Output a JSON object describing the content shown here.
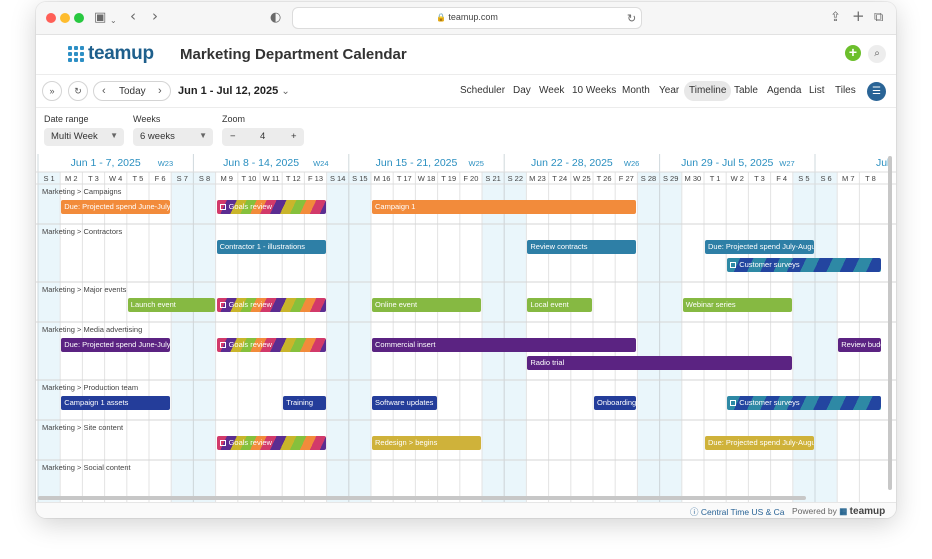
{
  "browser": {
    "url": "teamup.com",
    "traffic_lights": [
      "#ff5f57",
      "#febc2e",
      "#28c840"
    ]
  },
  "app": {
    "logo": "teamup",
    "title": "Marketing Department Calendar",
    "add_label": "+",
    "search_label": "⌕"
  },
  "toolbar": {
    "today": "Today",
    "range": "Jun 1 - Jul 12, 2025",
    "views": [
      "Scheduler",
      "Day",
      "Week",
      "10 Weeks",
      "Month",
      "Year",
      "Timeline",
      "Table",
      "Agenda",
      "List",
      "Tiles"
    ],
    "active_view": "Timeline"
  },
  "controls": {
    "date_range_label": "Date range",
    "date_range_value": "Multi Week",
    "weeks_label": "Weeks",
    "weeks_value": "6 weeks",
    "zoom_label": "Zoom",
    "zoom_value": "4",
    "zoom_minus": "−",
    "zoom_plus": "+"
  },
  "timeline": {
    "weeks": [
      {
        "range": "Jun 1 - 7, 2025",
        "week": "W23"
      },
      {
        "range": "Jun 8 - 14, 2025",
        "week": "W24"
      },
      {
        "range": "Jun 15 - 21, 2025",
        "week": "W25"
      },
      {
        "range": "Jun 22 - 28, 2025",
        "week": "W26"
      },
      {
        "range": "Jun 29 - Jul 5, 2025",
        "week": "W27"
      },
      {
        "range": "Jul",
        "week": ""
      }
    ],
    "days": [
      "S 1",
      "M 2",
      "T 3",
      "W 4",
      "T 5",
      "F 6",
      "S 7",
      "S 8",
      "M 9",
      "T 10",
      "W 11",
      "T 12",
      "F 13",
      "S 14",
      "S 15",
      "M 16",
      "T 17",
      "W 18",
      "T 19",
      "F 20",
      "S 21",
      "S 22",
      "M 23",
      "T 24",
      "W 25",
      "T 26",
      "F 27",
      "S 28",
      "S 29",
      "M 30",
      "T 1",
      "W 2",
      "T 3",
      "F 4",
      "S 5",
      "S 6",
      "M 7",
      "T 8"
    ],
    "weekend_days": [
      0,
      6,
      7,
      13,
      14,
      20,
      21,
      27,
      28,
      34,
      35
    ],
    "rows": [
      {
        "label": "Marketing > Campaigns",
        "lanes": 1
      },
      {
        "label": "Marketing > Contractors",
        "lanes": 2
      },
      {
        "label": "Marketing > Major events",
        "lanes": 1
      },
      {
        "label": "Marketing > Media advertising",
        "lanes": 2
      },
      {
        "label": "Marketing > Production team",
        "lanes": 1
      },
      {
        "label": "Marketing > Site content",
        "lanes": 1
      },
      {
        "label": "Marketing > Social content",
        "lanes": 1
      }
    ],
    "events": [
      {
        "row": 0,
        "lane": 0,
        "start": 1,
        "end": 6,
        "title": "Due: Projected spend June-July",
        "color": "#f28b3b"
      },
      {
        "row": 0,
        "lane": 0,
        "start": 8,
        "end": 13,
        "title": "Goals review",
        "style": "multi",
        "checkbox": true
      },
      {
        "row": 0,
        "lane": 0,
        "start": 15,
        "end": 27,
        "title": "Campaign 1",
        "color": "#f28b3b"
      },
      {
        "row": 1,
        "lane": 0,
        "start": 8,
        "end": 13,
        "title": "Contractor 1 - illustrations",
        "color": "#2e7fa6"
      },
      {
        "row": 1,
        "lane": 0,
        "start": 22,
        "end": 27,
        "title": "Review contracts",
        "color": "#2e7fa6"
      },
      {
        "row": 1,
        "lane": 0,
        "start": 30,
        "end": 35,
        "title": "Due: Projected spend July-August",
        "color": "#2e7fa6"
      },
      {
        "row": 1,
        "lane": 1,
        "start": 31,
        "end": 38,
        "title": "Customer surveys",
        "style": "stripe-blue",
        "checkbox": true
      },
      {
        "row": 2,
        "lane": 0,
        "start": 4,
        "end": 8,
        "title": "Launch event",
        "color": "#86b942"
      },
      {
        "row": 2,
        "lane": 0,
        "start": 8,
        "end": 13,
        "title": "Goals review",
        "style": "multi",
        "checkbox": true
      },
      {
        "row": 2,
        "lane": 0,
        "start": 15,
        "end": 20,
        "title": "Online event",
        "color": "#86b942"
      },
      {
        "row": 2,
        "lane": 0,
        "start": 22,
        "end": 25,
        "title": "Local event",
        "color": "#86b942"
      },
      {
        "row": 2,
        "lane": 0,
        "start": 29,
        "end": 34,
        "title": "Webinar series",
        "color": "#86b942"
      },
      {
        "row": 3,
        "lane": 0,
        "start": 1,
        "end": 6,
        "title": "Due: Projected spend June-July",
        "color": "#5b2382"
      },
      {
        "row": 3,
        "lane": 0,
        "start": 8,
        "end": 13,
        "title": "Goals review",
        "style": "multi",
        "checkbox": true
      },
      {
        "row": 3,
        "lane": 0,
        "start": 15,
        "end": 27,
        "title": "Commercial insert",
        "color": "#5b2382"
      },
      {
        "row": 3,
        "lane": 0,
        "start": 36,
        "end": 38,
        "title": "Review budget",
        "color": "#5b2382"
      },
      {
        "row": 3,
        "lane": 1,
        "start": 22,
        "end": 34,
        "title": "Radio trial",
        "color": "#5b2382"
      },
      {
        "row": 4,
        "lane": 0,
        "start": 1,
        "end": 6,
        "title": "Campaign 1 assets",
        "color": "#243d9a"
      },
      {
        "row": 4,
        "lane": 0,
        "start": 11,
        "end": 13,
        "title": "Training",
        "color": "#243d9a"
      },
      {
        "row": 4,
        "lane": 0,
        "start": 15,
        "end": 18,
        "title": "Software updates",
        "color": "#243d9a"
      },
      {
        "row": 4,
        "lane": 0,
        "start": 25,
        "end": 27,
        "title": "Onboarding",
        "color": "#243d9a"
      },
      {
        "row": 4,
        "lane": 0,
        "start": 31,
        "end": 38,
        "title": "Customer surveys",
        "style": "stripe-blue",
        "checkbox": true
      },
      {
        "row": 5,
        "lane": 0,
        "start": 8,
        "end": 13,
        "title": "Goals review",
        "style": "multi",
        "checkbox": true
      },
      {
        "row": 5,
        "lane": 0,
        "start": 15,
        "end": 20,
        "title": "Redesign > begins",
        "color": "#cfb23a"
      },
      {
        "row": 5,
        "lane": 0,
        "start": 30,
        "end": 35,
        "title": "Due: Projected spend July-August",
        "color": "#cfb23a"
      }
    ]
  },
  "footer": {
    "timezone": "Central Time US & Ca",
    "powered": "Powered by",
    "brand": "teamup"
  }
}
